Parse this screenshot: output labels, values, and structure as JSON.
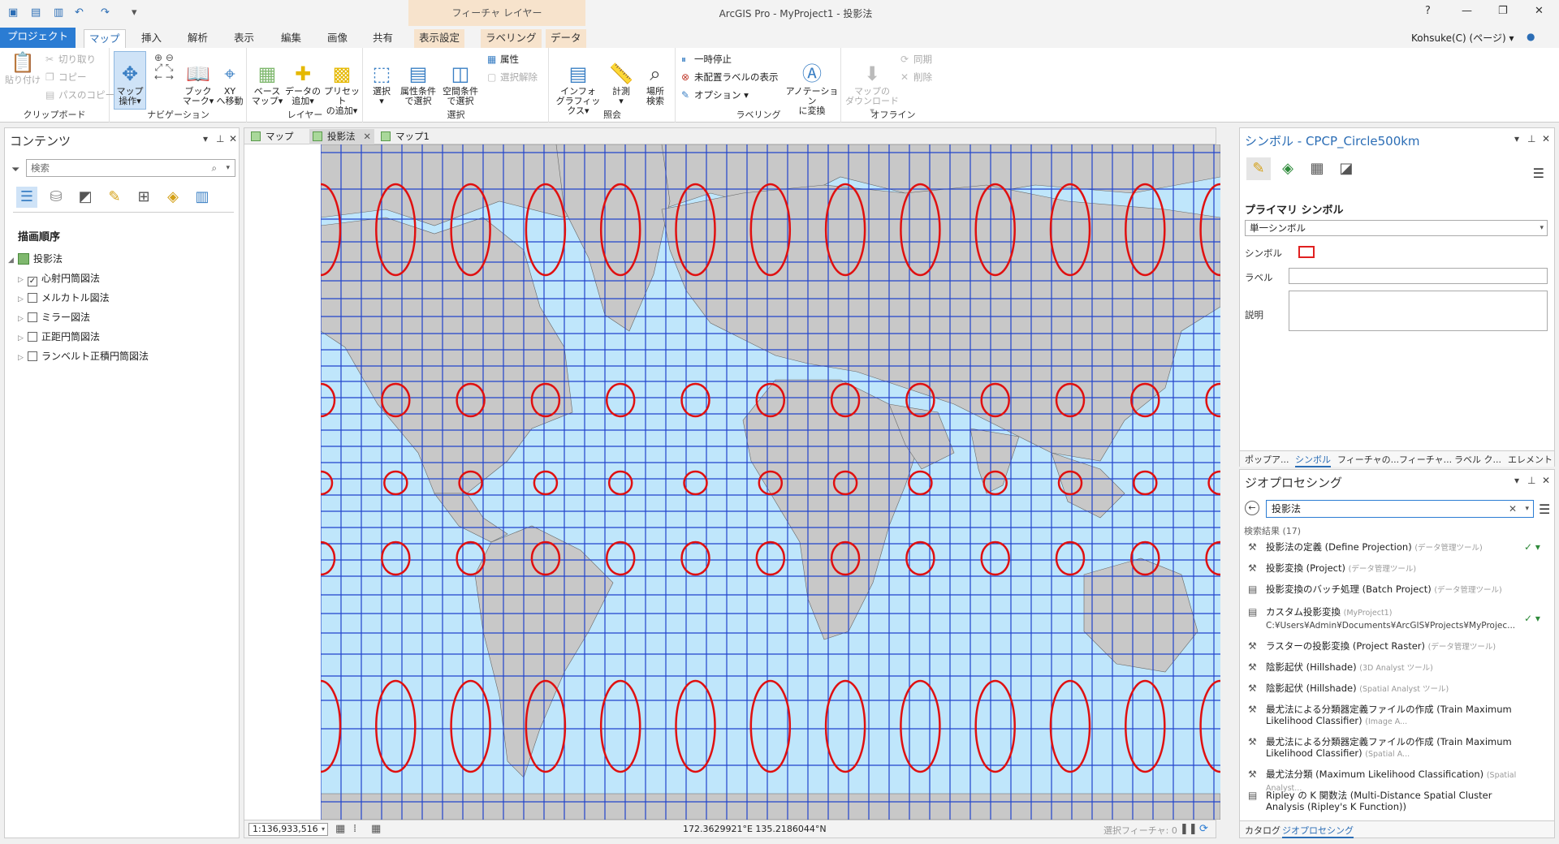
{
  "app": {
    "title": "ArcGIS Pro - MyProject1 - 投影法",
    "context_group": "フィーチャ レイヤー",
    "help": "?",
    "window_controls": [
      "—",
      "❐",
      "✕"
    ],
    "user": "Kohsuke(C) (ページ) ▾"
  },
  "ribbon_tabs": [
    {
      "label": "プロジェクト"
    },
    {
      "label": "マップ"
    },
    {
      "label": "挿入"
    },
    {
      "label": "解析"
    },
    {
      "label": "表示"
    },
    {
      "label": "編集"
    },
    {
      "label": "画像"
    },
    {
      "label": "共有"
    },
    {
      "label": "表示設定"
    },
    {
      "label": "ラベリング"
    },
    {
      "label": "データ"
    }
  ],
  "ribbon": {
    "clipboard": {
      "label": "クリップボード",
      "paste": "貼り付け",
      "cut": "切り取り",
      "copy": "コピー",
      "copy_path": "パスのコピー"
    },
    "navigation": {
      "label": "ナビゲーション",
      "explore": "マップ\n操作▾",
      "bookmarks": "ブック\nマーク▾",
      "goto_xy": "XY\nへ移動"
    },
    "layer": {
      "label": "レイヤー",
      "basemap": "ベース\nマップ▾",
      "add_data": "データの\n追加▾",
      "add_preset": "プリセット\nの追加▾"
    },
    "selection": {
      "label": "選択",
      "select": "選択\n▾",
      "select_by_attr": "属性条件\nで選択",
      "select_by_loc": "空間条件\nで選択",
      "attributes": "属性",
      "clear": "選択解除"
    },
    "inquiry": {
      "label": "照会",
      "infographics": "インフォ\nグラフィックス▾",
      "measure": "計測\n▾",
      "locate": "場所\n検索"
    },
    "labeling": {
      "label": "ラベリング",
      "pause": "一時停止",
      "unplaced": "未配置ラベルの表示",
      "options": "オプション ▾",
      "convert": "アノテーション\nに変換"
    },
    "offline": {
      "label": "オフライン",
      "download": "マップの\nダウンロード▾",
      "sync": "同期",
      "remove": "削除"
    }
  },
  "contents": {
    "title": "コンテンツ",
    "search_placeholder": "検索",
    "draw_order": "描画順序",
    "map_name": "投影法",
    "layers": [
      {
        "name": "心射円筒図法",
        "checked": "✓"
      },
      {
        "name": "メルカトル図法",
        "checked": ""
      },
      {
        "name": "ミラー図法",
        "checked": ""
      },
      {
        "name": "正距円筒図法",
        "checked": ""
      },
      {
        "name": "ランベルト正積円筒図法",
        "checked": ""
      }
    ]
  },
  "map_tabs": [
    {
      "label": "マップ"
    },
    {
      "label": "投影法"
    },
    {
      "label": "マップ1"
    }
  ],
  "map_status": {
    "scale": "1:136,933,516",
    "coordinates": "172.3629921°E 135.2186044°N",
    "selected_features": "選択フィーチャ: 0"
  },
  "map_colors": {
    "ocean": "#bfe6fb",
    "land": "#c8c8c8",
    "grid": "#2244cc",
    "circle": "#e01010"
  },
  "symbology": {
    "title": "シンボル - CPCP_Circle500km",
    "primary": "プライマリ シンボル",
    "type": "単一シンボル",
    "symbol_label": "シンボル",
    "label_label": "ラベル",
    "desc_label": "説明",
    "bottom_tabs": [
      "ポップア...",
      "シンボル",
      "フィーチャの...",
      "フィーチャ...",
      "ラベル ク...",
      "エレメント"
    ]
  },
  "geoprocessing": {
    "title": "ジオプロセシング",
    "search_value": "投影法",
    "results_count": "検索結果 (17)",
    "items": [
      {
        "name": "投影法の定義 (Define Projection)",
        "box": "(データ管理ツール)",
        "check": "✓ ▾",
        "path": ""
      },
      {
        "name": "投影変換 (Project)",
        "box": "(データ管理ツール)",
        "check": "",
        "path": ""
      },
      {
        "name": "投影変換のバッチ処理 (Batch Project)",
        "box": "(データ管理ツール)",
        "check": "",
        "path": ""
      },
      {
        "name": "カスタム投影変換",
        "box": "(MyProject1)",
        "check": "✓ ▾",
        "path": "C:¥Users¥Admin¥Documents¥ArcGIS¥Projects¥MyProjec..."
      },
      {
        "name": "ラスターの投影変換 (Project Raster)",
        "box": "(データ管理ツール)",
        "check": "",
        "path": ""
      },
      {
        "name": "陰影起伏 (Hillshade)",
        "box": "(3D Analyst ツール)",
        "check": "",
        "path": ""
      },
      {
        "name": "陰影起伏 (Hillshade)",
        "box": "(Spatial Analyst ツール)",
        "check": "",
        "path": ""
      },
      {
        "name": "最尤法による分類器定義ファイルの作成 (Train Maximum Likelihood Classifier)",
        "box": "(Image A...",
        "check": "",
        "path": ""
      },
      {
        "name": "最尤法による分類器定義ファイルの作成 (Train Maximum Likelihood Classifier)",
        "box": "(Spatial A...",
        "check": "",
        "path": ""
      },
      {
        "name": "最尤法分類 (Maximum Likelihood Classification)",
        "box": "(Spatial Analyst...",
        "check": "",
        "path": ""
      },
      {
        "name": "Ripley の K 関数法 (Multi-Distance Spatial Cluster Analysis (Ripley's K Function))",
        "box": "",
        "check": "",
        "path": ""
      }
    ],
    "bottom_tabs": [
      "カタログ",
      "ジオプロセシング"
    ]
  }
}
